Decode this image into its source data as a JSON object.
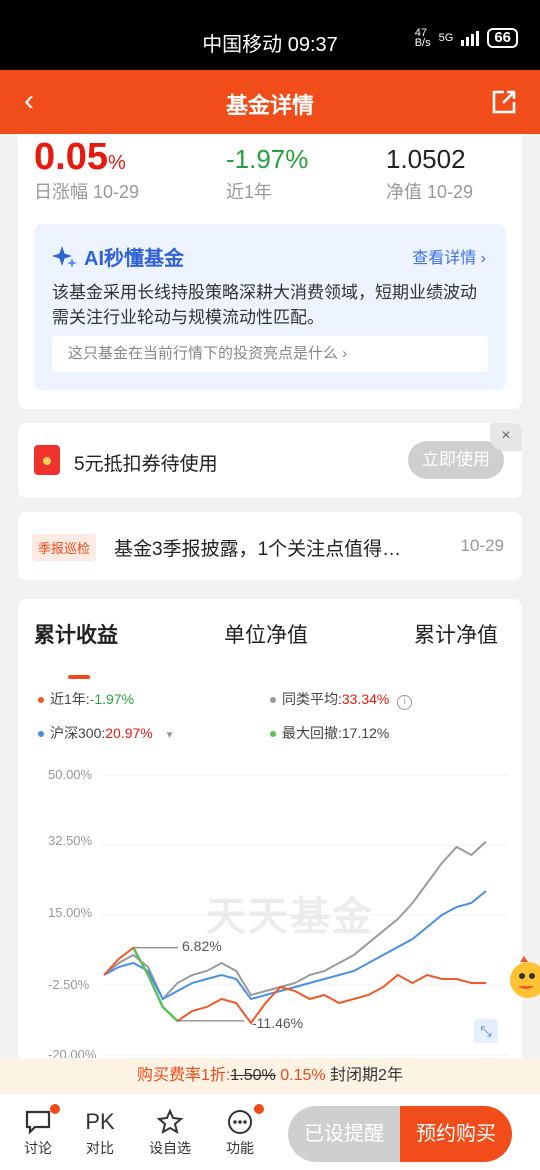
{
  "status_bar": {
    "carrier_time": "中国移动 09:37",
    "net_speed": "47\nB/s",
    "network": "5G",
    "battery": "66"
  },
  "nav": {
    "title": "基金详情",
    "back_icon": "chevron-left-icon",
    "share_icon": "share-icon"
  },
  "summary": {
    "daily_change": "0.05",
    "daily_unit": "%",
    "daily_label": "日涨幅 10-29",
    "year_change": "-1.97%",
    "year_label": "近1年",
    "nav_value": "1.0502",
    "nav_label": "净值 10-29"
  },
  "ai": {
    "title": "AI秒懂基金",
    "link": "查看详情 ›",
    "text": "该基金采用长线持股策略深耕大消费领域，短期业绩波动需关注行业轮动与规模流动性匹配。",
    "question": "这只基金在当前行情下的投资亮点是什么 ›"
  },
  "coupon": {
    "text": "5元抵扣券待使用",
    "button": "立即使用",
    "close": "×"
  },
  "report": {
    "tag": "季报巡检",
    "text": "基金3季报披露，1个关注点值得…",
    "date": "10-29"
  },
  "chart_tabs": {
    "tab1": "累计收益",
    "tab2": "单位净值",
    "tab3": "累计净值"
  },
  "legend": {
    "fund_label": "近1年:",
    "fund_value": "-1.97%",
    "peer_label": "同类平均:",
    "peer_value": "33.34%",
    "index_label": "沪深300:",
    "index_value": "20.97%",
    "drawdown_label": "最大回撤:",
    "drawdown_value": "17.12%"
  },
  "colors": {
    "fund": "#ef5a28",
    "peer": "#9a9a9a",
    "index": "#4a90e2",
    "drawdown": "#5cc05c",
    "accent": "#f14d1b"
  },
  "chart_data": {
    "type": "line",
    "yticks": [
      "50.00%",
      "32.50%",
      "15.00%",
      "-2.50%",
      "-20.00%"
    ],
    "ylim": [
      -20,
      50
    ],
    "watermark": "天天基金",
    "annotations": {
      "high": "6.82%",
      "low": "-11.46%"
    },
    "max_drawdown": {
      "peak": 6.82,
      "trough": -11.46
    },
    "series": [
      {
        "name": "同类平均",
        "values": [
          0,
          3,
          5,
          2,
          -6,
          -2,
          0,
          1,
          3,
          1,
          -5,
          -4,
          -3,
          -2,
          0,
          1,
          3,
          5,
          8,
          11,
          14,
          18,
          23,
          28,
          32,
          30,
          33.3
        ]
      },
      {
        "name": "沪深300",
        "values": [
          0,
          2,
          3,
          1,
          -6,
          -4,
          -2,
          -1,
          0,
          -1,
          -6,
          -5,
          -4,
          -3,
          -2,
          -1,
          0,
          1,
          3,
          5,
          7,
          9,
          12,
          15,
          17,
          18,
          21
        ]
      },
      {
        "name": "近1年",
        "values": [
          0,
          4,
          6.8,
          0,
          -8,
          -11.5,
          -9,
          -8,
          -6,
          -7,
          -12,
          -7,
          -3,
          -4,
          -6,
          -5,
          -7,
          -6,
          -5,
          -3,
          0,
          -2,
          0,
          -1,
          -1,
          -2,
          -2
        ]
      }
    ]
  },
  "fee": {
    "label": "购买费率1折:",
    "original": "1.50%",
    "discount": "0.15%",
    "period": "封闭期2年"
  },
  "bottom_bar": {
    "discuss": "讨论",
    "compare": "对比",
    "compare_icon": "PK",
    "watchlist": "设自选",
    "functions": "功能",
    "reminder": "已设提醒",
    "buy": "预约购买"
  }
}
